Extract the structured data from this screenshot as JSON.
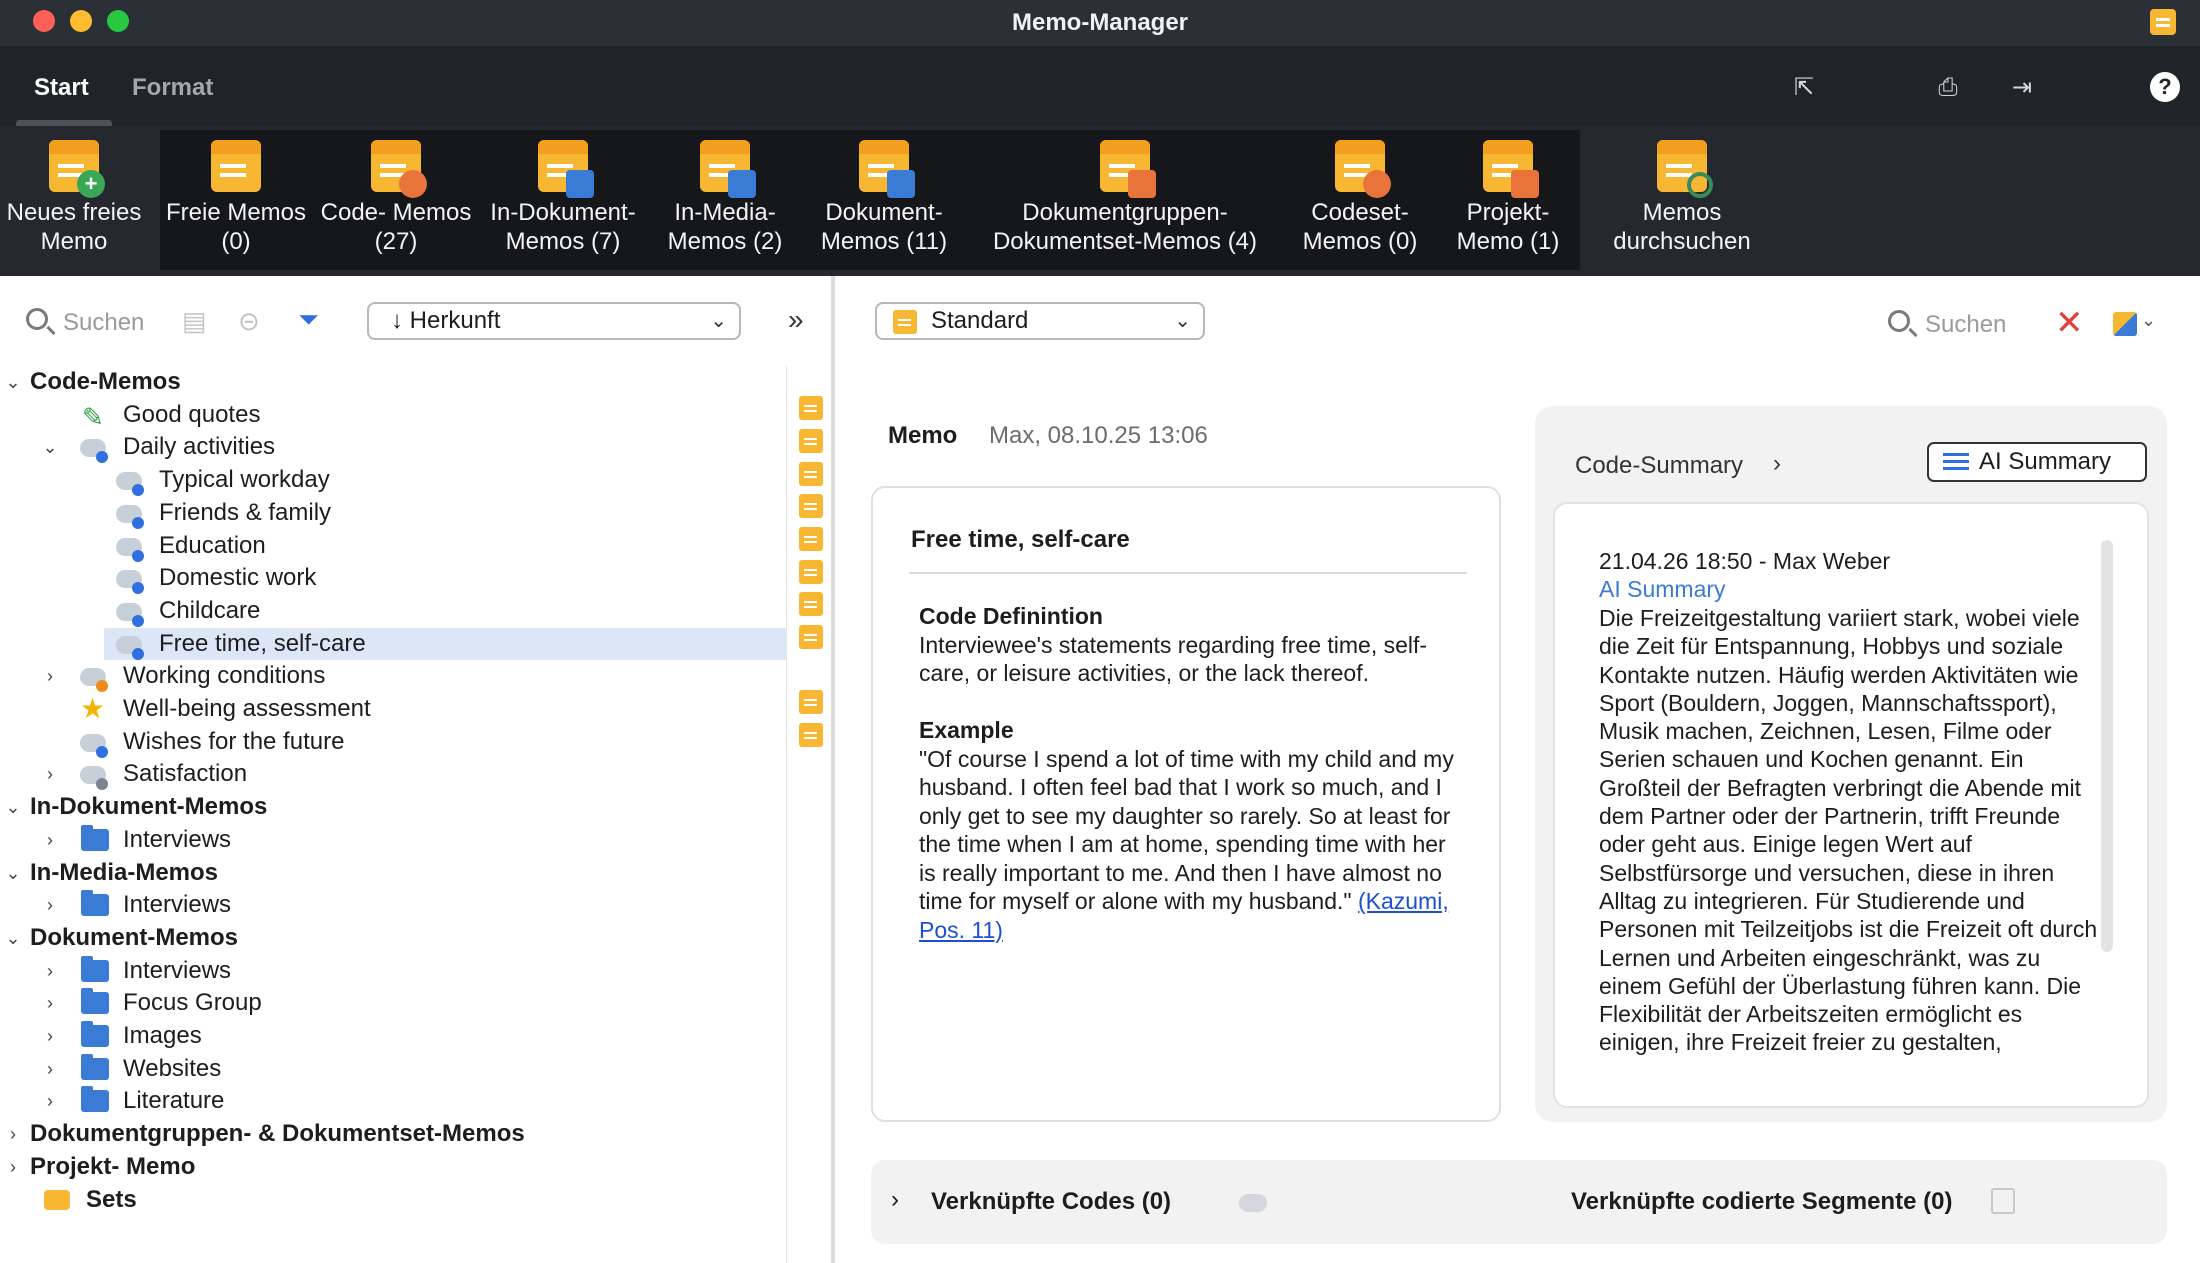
{
  "window": {
    "title": "Memo-Manager"
  },
  "tabs": [
    {
      "label": "Start",
      "active": true
    },
    {
      "label": "Format",
      "active": false
    }
  ],
  "ribbon": {
    "new_free_memo": [
      "Neues freies",
      "Memo"
    ],
    "free_memos": [
      "Freie Memos",
      "(0)"
    ],
    "code_memos": [
      "Code- Memos",
      "(27)"
    ],
    "in_doc_memos": [
      "In-Dokument-",
      "Memos (7)"
    ],
    "in_media_memos": [
      "In-Media-",
      "Memos (2)"
    ],
    "doc_memos": [
      "Dokument-",
      "Memos (11)"
    ],
    "docgroup_memos": [
      "Dokumentgruppen-",
      "Dokumentset-Memos (4)"
    ],
    "codeset_memos": [
      "Codeset-",
      "Memos (0)"
    ],
    "project_memo": [
      "Projekt-",
      "Memo (1)"
    ],
    "search_memos": [
      "Memos",
      "durchsuchen"
    ]
  },
  "left_toolbar": {
    "search_placeholder": "Suchen",
    "sort_dropdown": "Herkunft",
    "expand_icon": "double-chevron-right-icon"
  },
  "tree": [
    {
      "label": "Code-Memos",
      "level": 0,
      "bold": true,
      "expanded": true
    },
    {
      "label": "Good quotes",
      "level": 1,
      "icon": "pen",
      "memo": true
    },
    {
      "label": "Daily activities",
      "level": 1,
      "icon": "code",
      "expanded": true,
      "memo": true
    },
    {
      "label": "Typical workday",
      "level": 2,
      "icon": "code",
      "memo": true
    },
    {
      "label": "Friends & family",
      "level": 2,
      "icon": "code",
      "memo": true
    },
    {
      "label": "Education",
      "level": 2,
      "icon": "code",
      "memo": true
    },
    {
      "label": "Domestic work",
      "level": 2,
      "icon": "code",
      "memo": true
    },
    {
      "label": "Childcare",
      "level": 2,
      "icon": "code",
      "memo": true
    },
    {
      "label": "Free time, self-care",
      "level": 2,
      "icon": "code",
      "memo": true,
      "selected": true
    },
    {
      "label": "Working conditions",
      "level": 1,
      "icon": "code-orange",
      "collapsed": true
    },
    {
      "label": "Well-being assessment",
      "level": 1,
      "icon": "star",
      "memo": true
    },
    {
      "label": "Wishes for the future",
      "level": 1,
      "icon": "code",
      "memo": true
    },
    {
      "label": "Satisfaction",
      "level": 1,
      "icon": "code-gray",
      "collapsed": true
    },
    {
      "label": "In-Dokument-Memos",
      "level": 0,
      "bold": true,
      "expanded": true
    },
    {
      "label": "Interviews",
      "level": 1,
      "icon": "folder",
      "collapsed": true
    },
    {
      "label": "In-Media-Memos",
      "level": 0,
      "bold": true,
      "expanded": true
    },
    {
      "label": "Interviews",
      "level": 1,
      "icon": "folder",
      "collapsed": true
    },
    {
      "label": "Dokument-Memos",
      "level": 0,
      "bold": true,
      "expanded": true
    },
    {
      "label": "Interviews",
      "level": 1,
      "icon": "folder",
      "collapsed": true
    },
    {
      "label": "Focus Group",
      "level": 1,
      "icon": "folder",
      "collapsed": true
    },
    {
      "label": "Images",
      "level": 1,
      "icon": "folder",
      "collapsed": true
    },
    {
      "label": "Websites",
      "level": 1,
      "icon": "folder",
      "collapsed": true
    },
    {
      "label": "Literature",
      "level": 1,
      "icon": "folder",
      "collapsed": true
    },
    {
      "label": "Dokumentgruppen- & Dokumentset-Memos",
      "level": 0,
      "bold": true,
      "collapsed": true
    },
    {
      "label": "Projekt- Memo",
      "level": 0,
      "bold": true,
      "collapsed": true
    },
    {
      "label": "Sets",
      "level": 0,
      "bold": true,
      "icon": "sets"
    }
  ],
  "right_toolbar": {
    "memo_type_dropdown": "Standard",
    "search_placeholder": "Suchen"
  },
  "memo": {
    "label": "Memo",
    "meta": "Max, 08.10.25 13:06",
    "title": "Free time, self-care",
    "def_heading": "Code Definintion",
    "def_text": "Interviewee's statements regarding free time, self-care, or leisure activities, or the lack thereof.",
    "example_heading": "Example",
    "example_text": "\"Of course I spend a lot of time with my child and my husband.  I often feel bad that I work so much, and I only get to see my daughter so rarely. So at least for the time when I am at home, spending time with her is really important to me. And then I have almost no time for myself or alone with my husband.\" ",
    "example_link": "(Kazumi, Pos. 11)"
  },
  "summary": {
    "title": "Code-Summary",
    "ai_button": "AI Summary",
    "meta": "21.04.26 18:50 - Max Weber",
    "ai_label": "AI Summary",
    "text": "Die Freizeitgestaltung variiert stark, wobei viele die Zeit für Entspannung, Hobbys und soziale Kontakte nutzen. Häufig werden Aktivitäten wie Sport (Bouldern, Joggen, Mannschaftssport), Musik machen, Zeichnen, Lesen, Filme oder Serien schauen und Kochen genannt. Ein Großteil der Befragten verbringt die Abende mit dem Partner oder der Partnerin, trifft Freunde oder geht aus. Einige legen Wert auf Selbstfürsorge und versuchen, diese in ihren Alltag zu integrieren. Für Studierende und Personen mit Teilzeitjobs ist die Freizeit oft durch Lernen und Arbeiten eingeschränkt, was zu einem Gefühl der Überlastung führen kann. Die Flexibilität der Arbeitszeiten ermöglicht es einigen, ihre Freizeit freier zu gestalten,"
  },
  "linked": {
    "codes": "Verknüpfte Codes (0)",
    "segments": "Verknüpfte codierte Segmente (0)"
  },
  "colors": {
    "accent": "#3a7bd5",
    "memo_yellow": "#f7b733",
    "ribbon_bg": "#25282e",
    "selection": "#dce6f7",
    "close_red": "#e0413a"
  }
}
